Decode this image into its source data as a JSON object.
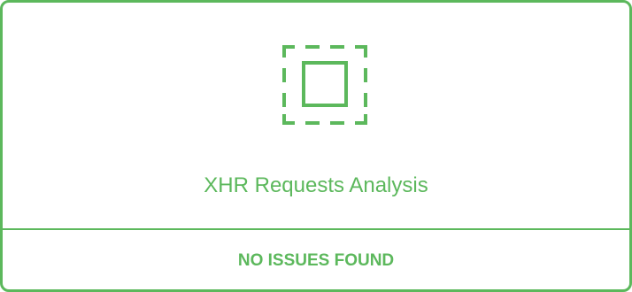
{
  "panel": {
    "icon": "selection-square-icon",
    "title": "XHR Requests Analysis",
    "status": "NO ISSUES FOUND",
    "accent_color": "#5cb85c"
  }
}
